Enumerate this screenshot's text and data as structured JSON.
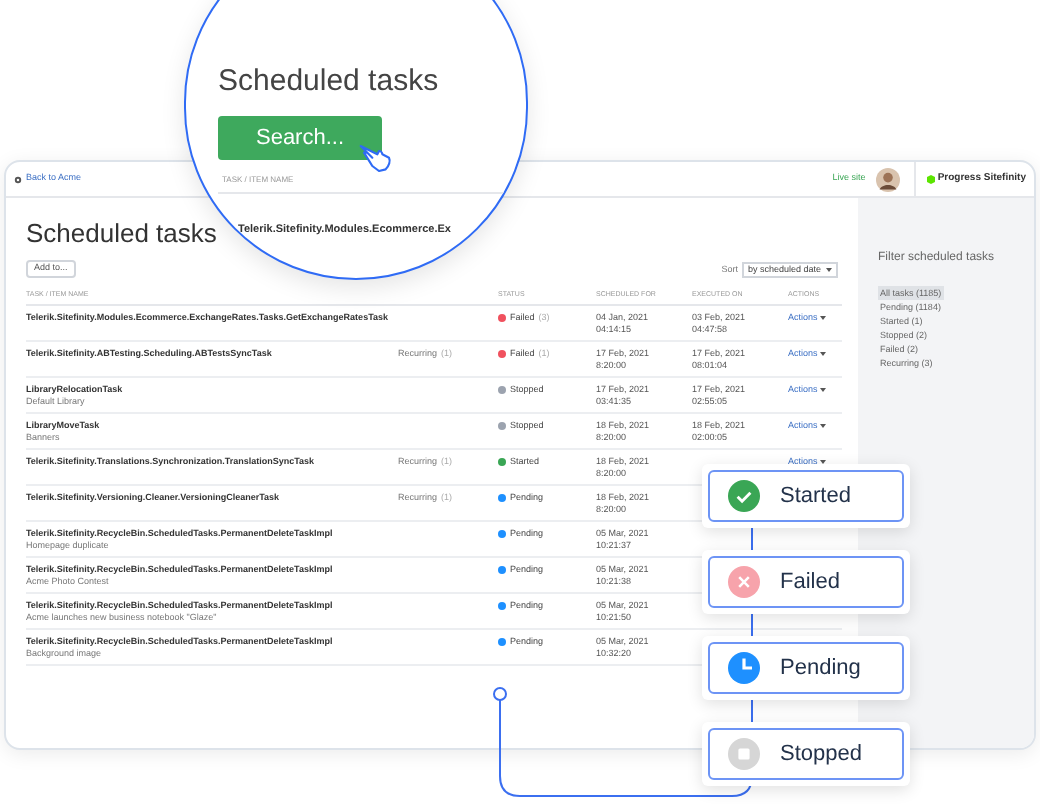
{
  "topbar": {
    "back_link": "Back to Acme",
    "live_site": "Live site",
    "logo": "Progress Sitefinity"
  },
  "page": {
    "title": "Scheduled tasks",
    "add_button": "Add to...",
    "sort_label": "Sort",
    "sort_value": "by scheduled date"
  },
  "table": {
    "columns": [
      "TASK / ITEM NAME",
      "STATUS",
      "SCHEDULED FOR",
      "EXECUTED ON",
      "ACTIONS"
    ],
    "rows": [
      {
        "name": "Telerik.Sitefinity.Modules.Ecommerce.ExchangeRates.Tasks.GetExchangeRatesTask",
        "status": {
          "kind": "failed",
          "label": "Failed",
          "count": "(3)"
        },
        "scheduled": [
          "04 Jan, 2021",
          "04:14:15"
        ],
        "executed": [
          "03 Feb, 2021",
          "04:47:58"
        ],
        "actions": "Actions"
      },
      {
        "name": "Telerik.Sitefinity.ABTesting.Scheduling.ABTestsSyncTask",
        "recurring": "Recurring",
        "recurring_count": "(1)",
        "status": {
          "kind": "failed",
          "label": "Failed",
          "count": "(1)"
        },
        "scheduled": [
          "17 Feb, 2021",
          "8:20:00"
        ],
        "executed": [
          "17 Feb, 2021",
          "08:01:04"
        ],
        "actions": "Actions"
      },
      {
        "name": "LibraryRelocationTask",
        "item": "Default Library",
        "status": {
          "kind": "stopped",
          "label": "Stopped"
        },
        "scheduled": [
          "17 Feb, 2021",
          "03:41:35"
        ],
        "executed": [
          "17 Feb, 2021",
          "02:55:05"
        ],
        "actions": "Actions"
      },
      {
        "name": "LibraryMoveTask",
        "item": "Banners",
        "status": {
          "kind": "stopped",
          "label": "Stopped"
        },
        "scheduled": [
          "18 Feb, 2021",
          "8:20:00"
        ],
        "executed": [
          "18 Feb, 2021",
          "02:00:05"
        ],
        "actions": "Actions"
      },
      {
        "name": "Telerik.Sitefinity.Translations.Synchronization.TranslationSyncTask",
        "recurring": "Recurring",
        "recurring_count": "(1)",
        "status": {
          "kind": "started",
          "label": "Started"
        },
        "scheduled": [
          "18 Feb, 2021",
          "8:20:00"
        ],
        "actions": "Actions"
      },
      {
        "name": "Telerik.Sitefinity.Versioning.Cleaner.VersioningCleanerTask",
        "recurring": "Recurring",
        "recurring_count": "(1)",
        "status": {
          "kind": "pending",
          "label": "Pending"
        },
        "scheduled": [
          "18 Feb, 2021",
          "8:20:00"
        ]
      },
      {
        "name": "Telerik.Sitefinity.RecycleBin.ScheduledTasks.PermanentDeleteTaskImpl",
        "item": "Homepage duplicate",
        "status": {
          "kind": "pending",
          "label": "Pending"
        },
        "scheduled": [
          "05 Mar, 2021",
          "10:21:37"
        ]
      },
      {
        "name": "Telerik.Sitefinity.RecycleBin.ScheduledTasks.PermanentDeleteTaskImpl",
        "item": "Acme Photo Contest",
        "status": {
          "kind": "pending",
          "label": "Pending"
        },
        "scheduled": [
          "05 Mar, 2021",
          "10:21:38"
        ]
      },
      {
        "name": "Telerik.Sitefinity.RecycleBin.ScheduledTasks.PermanentDeleteTaskImpl",
        "item": "Acme launches new business notebook \"Glaze\"",
        "status": {
          "kind": "pending",
          "label": "Pending"
        },
        "scheduled": [
          "05 Mar, 2021",
          "10:21:50"
        ]
      },
      {
        "name": "Telerik.Sitefinity.RecycleBin.ScheduledTasks.PermanentDeleteTaskImpl",
        "item": "Background image",
        "status": {
          "kind": "pending",
          "label": "Pending"
        },
        "scheduled": [
          "05 Mar, 2021",
          "10:32:20"
        ]
      }
    ]
  },
  "sidebar": {
    "title": "Filter scheduled tasks",
    "items": [
      {
        "label": "All tasks (1185)",
        "selected": true
      },
      {
        "label": "Pending (1184)",
        "selected": false
      },
      {
        "label": "Started (1)",
        "selected": false
      },
      {
        "label": "Stopped (2)",
        "selected": false
      },
      {
        "label": "Failed (2)",
        "selected": false
      },
      {
        "label": "Recurring (3)",
        "selected": false
      }
    ]
  },
  "magnifier": {
    "title": "Scheduled tasks",
    "button": "Search...",
    "column": "TASK / ITEM NAME",
    "row": "Telerik.Sitefinity.Modules.Ecommerce.Ex"
  },
  "legend": [
    {
      "kind": "started",
      "label": "Started"
    },
    {
      "kind": "failed",
      "label": "Failed"
    },
    {
      "kind": "pending",
      "label": "Pending"
    },
    {
      "kind": "stopped",
      "label": "Stopped"
    }
  ]
}
